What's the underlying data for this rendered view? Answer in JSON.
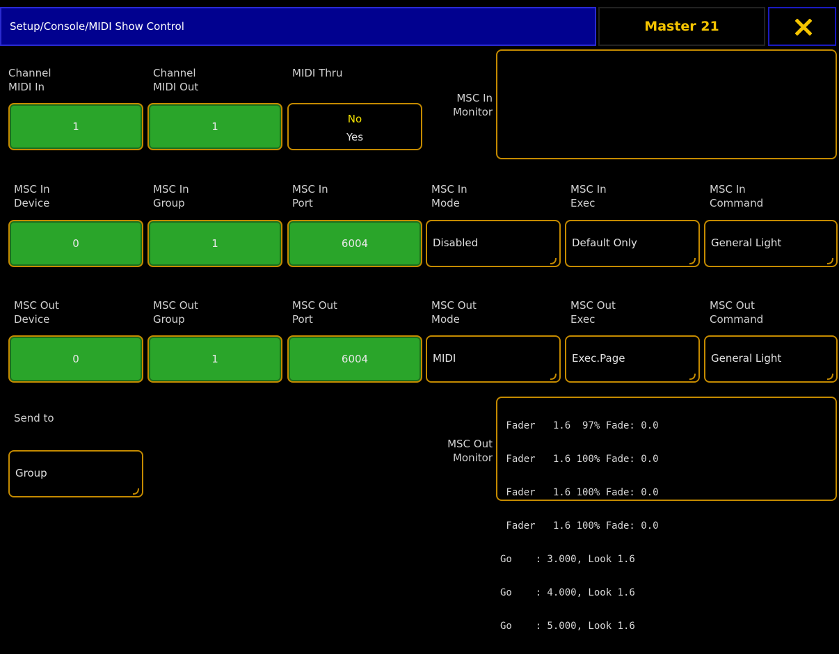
{
  "header": {
    "title": "Setup/Console/MIDI Show Control",
    "master": "Master 21",
    "close_icon": "close-x-icon"
  },
  "row1": {
    "channel_in": {
      "label": "Channel\nMIDI In",
      "value": "1"
    },
    "channel_out": {
      "label": "Channel\nMIDI Out",
      "value": "1"
    },
    "midi_thru": {
      "label": "MIDI Thru",
      "option_active": "No",
      "option_inactive": "Yes"
    },
    "msc_in_monitor": {
      "label": "MSC In\nMonitor"
    }
  },
  "row2": {
    "device": {
      "label": "MSC In\nDevice",
      "value": "0"
    },
    "group": {
      "label": "MSC In\nGroup",
      "value": "1"
    },
    "port": {
      "label": "MSC In\nPort",
      "value": "6004"
    },
    "mode": {
      "label": "MSC In\nMode",
      "value": "Disabled"
    },
    "exec": {
      "label": "MSC In\nExec",
      "value": "Default Only"
    },
    "command": {
      "label": "MSC In\nCommand",
      "value": "General Light"
    }
  },
  "row3": {
    "device": {
      "label": "MSC Out\nDevice",
      "value": "0"
    },
    "group": {
      "label": "MSC Out\nGroup",
      "value": "1"
    },
    "port": {
      "label": "MSC Out\nPort",
      "value": "6004"
    },
    "mode": {
      "label": "MSC Out\nMode",
      "value": "MIDI"
    },
    "exec": {
      "label": "MSC Out\nExec",
      "value": "Exec.Page"
    },
    "command": {
      "label": "MSC Out\nCommand",
      "value": "General Light"
    }
  },
  "row4": {
    "send_to": {
      "label": "Send to",
      "value": "Group"
    },
    "msc_out_monitor": {
      "label": "MSC Out\nMonitor",
      "lines": [
        " Fader   1.6  97% Fade: 0.0",
        " Fader   1.6 100% Fade: 0.0",
        " Fader   1.6 100% Fade: 0.0",
        " Fader   1.6 100% Fade: 0.0",
        "Go    : 3.000, Look 1.6",
        "Go    : 4.000, Look 1.6",
        "Go    : 5.000, Look 1.6"
      ]
    }
  },
  "colors": {
    "title_bg": "#01018f",
    "accent_border": "#c48a00",
    "button_green": "#2aa52a",
    "master_text": "#f5c400"
  }
}
